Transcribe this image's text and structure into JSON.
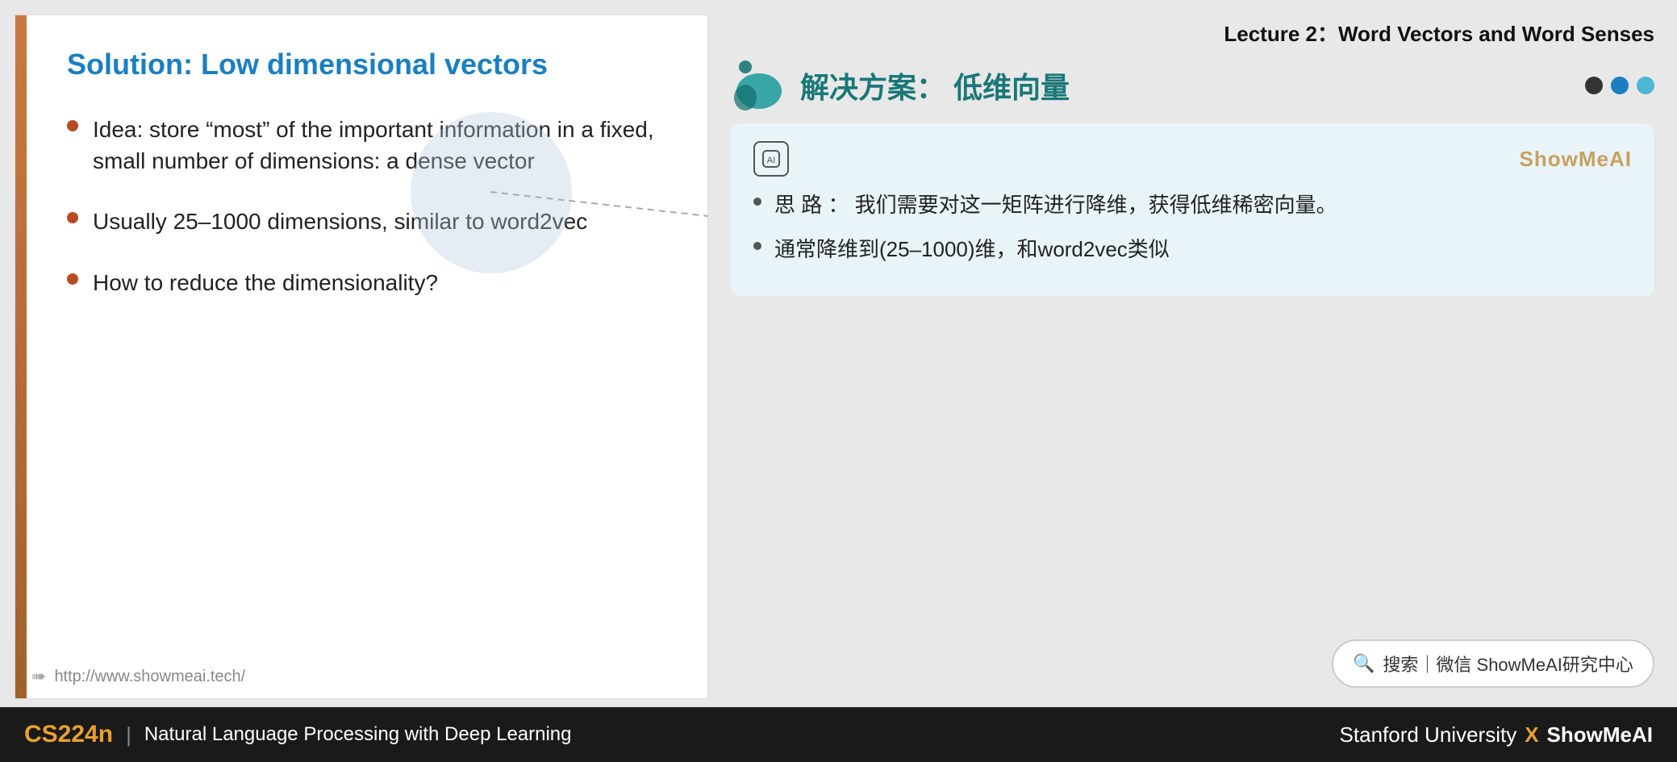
{
  "lecture": {
    "title": "Lecture 2：Word Vectors and Word Senses"
  },
  "slide": {
    "title": "Solution: Low dimensional vectors",
    "bullets": [
      {
        "id": 1,
        "text": "Idea: store “most” of the important information in a fixed, small number of dimensions: a dense vector"
      },
      {
        "id": 2,
        "text": "Usually 25–1000 dimensions, similar to word2vec"
      },
      {
        "id": 3,
        "text": "How to reduce the dimensionality?"
      }
    ],
    "footer_url": "http://www.showmeai.tech/"
  },
  "right_panel": {
    "heading": "解决方案： 低维向量",
    "brand": "ShowMeAI",
    "translation_card": {
      "bullets": [
        {
          "id": 1,
          "text": "思 路 ： 我们需要对这一矩阵进行降维，获得低维稀密向量。"
        },
        {
          "id": 2,
          "text": "通常降维到(25–1000)维，和word2vec类似"
        }
      ]
    },
    "nav_dots": [
      "dark",
      "teal",
      "light-teal"
    ]
  },
  "search_bar": {
    "icon": "🔍",
    "label": "搜索｜微信 ShowMeAI研究中心"
  },
  "bottom_bar": {
    "course_code": "CS224n",
    "divider": "|",
    "course_name": "Natural Language Processing with Deep Learning",
    "footer_right": "Stanford University",
    "x_label": "X",
    "showmeai_label": "ShowMeAI"
  }
}
